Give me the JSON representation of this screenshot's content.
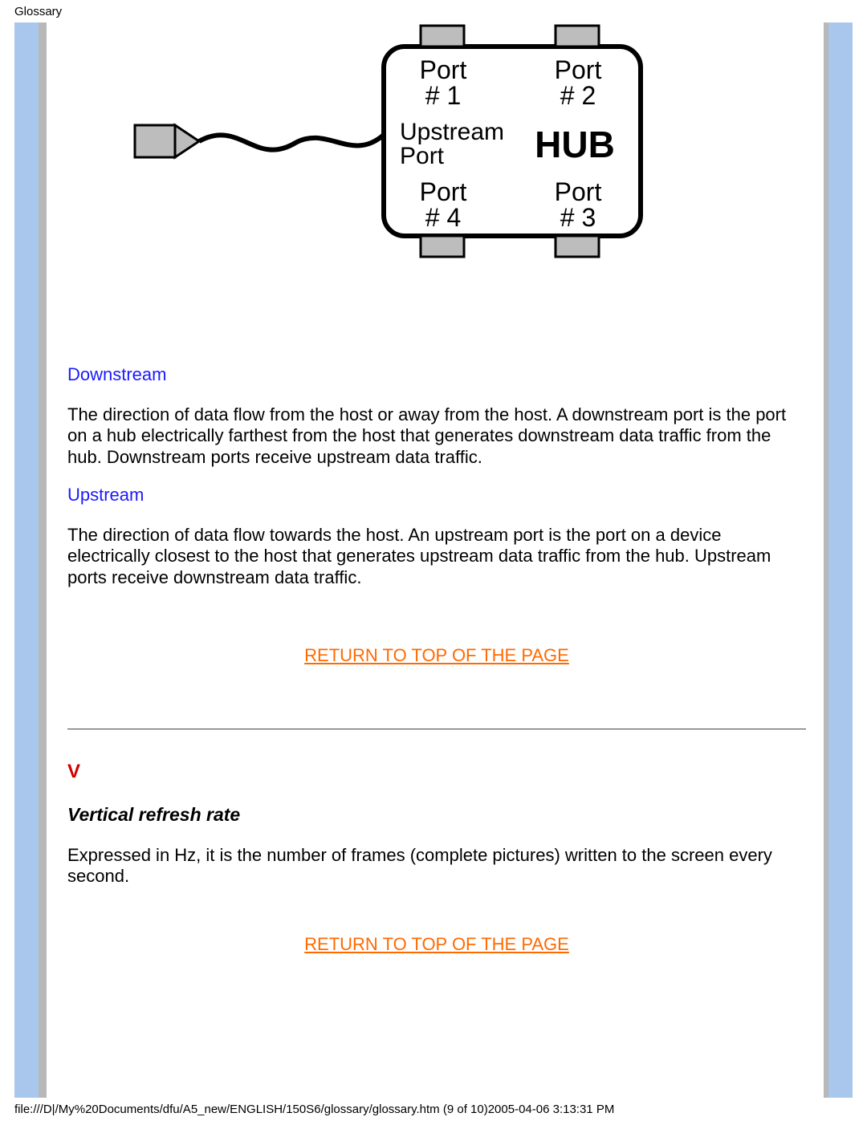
{
  "page_header": "Glossary",
  "diagram": {
    "port1": "Port\n# 1",
    "port2": "Port\n# 2",
    "port3": "Port\n# 3",
    "port4": "Port\n# 4",
    "upstream_port": "Upstream\nPort",
    "hub": "HUB"
  },
  "sections": {
    "downstream": {
      "title": "Downstream",
      "body": "The direction of data flow from the host or away from the host. A downstream port is the port on a hub electrically farthest from the host that generates downstream data traffic from the hub. Downstream ports receive upstream data traffic."
    },
    "upstream": {
      "title": "Upstream",
      "body": "The direction of data flow towards the host. An upstream port is the port on a device electrically closest to the host that generates upstream data traffic from the hub. Upstream ports receive downstream data traffic."
    },
    "letter_v": "V",
    "vertical_refresh": {
      "title": "Vertical refresh rate",
      "body": "Expressed in Hz, it is the number of frames (complete pictures) written to the screen every second."
    }
  },
  "return_link": "RETURN TO TOP OF THE PAGE",
  "footer": "file:///D|/My%20Documents/dfu/A5_new/ENGLISH/150S6/glossary/glossary.htm (9 of 10)2005-04-06 3:13:31 PM"
}
